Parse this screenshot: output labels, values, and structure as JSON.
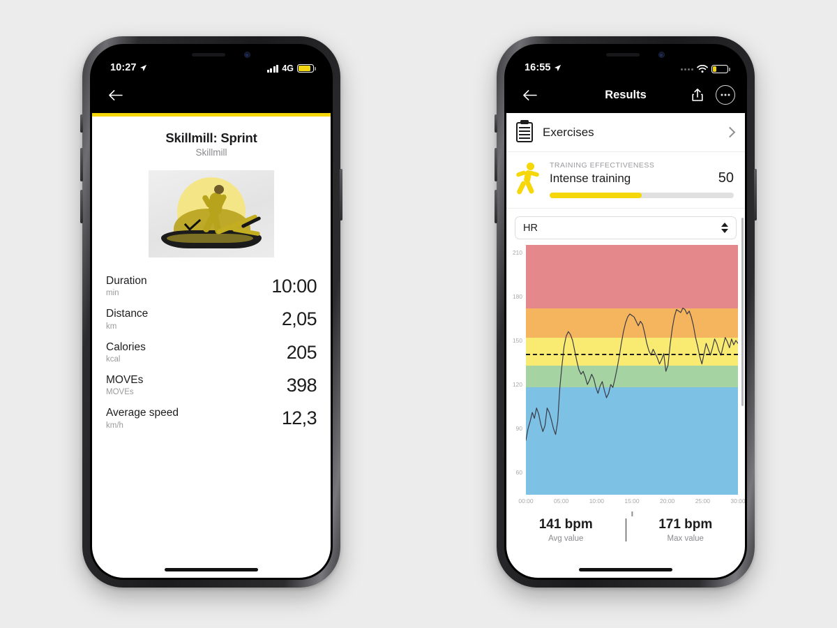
{
  "phone_left": {
    "status_bar": {
      "time": "10:27",
      "location_icon": "location-arrow-icon",
      "network": "4G",
      "signal_icon": "signal-bars-icon",
      "battery_icon": "battery-low-power-icon"
    },
    "nav": {
      "back_icon": "back-arrow-icon"
    },
    "workout": {
      "title": "Skillmill: Sprint",
      "subtitle": "Skillmill",
      "image_alt": "skillmill-treadmill-image"
    },
    "stats": [
      {
        "label": "Duration",
        "unit": "min",
        "value": "10:00"
      },
      {
        "label": "Distance",
        "unit": "km",
        "value": "2,05"
      },
      {
        "label": "Calories",
        "unit": "kcal",
        "value": "205"
      },
      {
        "label": "MOVEs",
        "unit": "MOVEs",
        "value": "398"
      },
      {
        "label": "Average speed",
        "unit": "km/h",
        "value": "12,3"
      }
    ]
  },
  "phone_right": {
    "status_bar": {
      "time": "16:55",
      "location_icon": "location-arrow-icon",
      "signal_icon": "signal-dots-icon",
      "wifi_icon": "wifi-icon",
      "battery_icon": "battery-low-icon"
    },
    "nav": {
      "back_icon": "back-arrow-icon",
      "title": "Results",
      "share_icon": "share-icon",
      "more_icon": "more-options-icon"
    },
    "exercises_row": {
      "label": "Exercises",
      "icon": "clipboard-icon",
      "chevron": "chevron-right-icon"
    },
    "effectiveness": {
      "caption": "TRAINING EFFECTIVENESS",
      "name": "Intense training",
      "score": "50",
      "progress_percent": 50,
      "icon": "running-figure-icon",
      "bar_color": "#f5d70a"
    },
    "selector": {
      "value": "HR",
      "icon": "stepper-arrows-icon"
    },
    "summary": [
      {
        "value": "141 bpm",
        "label": "Avg value"
      },
      {
        "value": "171 bpm",
        "label": "Max value"
      }
    ]
  },
  "chart_data": {
    "type": "line",
    "title": "HR",
    "xlabel": "",
    "ylabel": "",
    "ylim": [
      45,
      215
    ],
    "xlim": [
      0,
      30
    ],
    "grid": false,
    "legend": false,
    "y_ticks": [
      210,
      180,
      150,
      120,
      90,
      60
    ],
    "x_ticks": [
      "00:00",
      "05:00",
      "10:00",
      "15:00",
      "20:00",
      "25:00",
      "30:00"
    ],
    "average_line": {
      "value": 141,
      "style": "dashed",
      "color": "#1c1c1e",
      "label": "Avg value"
    },
    "zones": [
      {
        "name": "zone-1-very-light",
        "color": "#7dc1e5",
        "from": 45,
        "to": 118
      },
      {
        "name": "zone-2-light",
        "color": "#a5d4a2",
        "from": 118,
        "to": 133
      },
      {
        "name": "zone-3-moderate",
        "color": "#f9eb72",
        "from": 133,
        "to": 152
      },
      {
        "name": "zone-4-hard",
        "color": "#f5b45e",
        "from": 152,
        "to": 172
      },
      {
        "name": "zone-5-maximum",
        "color": "#e5888b",
        "from": 172,
        "to": 215
      }
    ],
    "series": [
      {
        "name": "Heart rate",
        "color": "#3a3a46",
        "unit": "bpm",
        "x": [
          0.0,
          0.3,
          0.6,
          0.9,
          1.2,
          1.5,
          1.8,
          2.1,
          2.4,
          2.7,
          3.0,
          3.3,
          3.6,
          3.9,
          4.2,
          4.5,
          4.8,
          5.1,
          5.4,
          5.7,
          6.0,
          6.3,
          6.6,
          6.9,
          7.2,
          7.5,
          7.8,
          8.1,
          8.4,
          8.7,
          9.0,
          9.3,
          9.6,
          9.9,
          10.2,
          10.5,
          10.8,
          11.1,
          11.4,
          11.7,
          12.0,
          12.3,
          12.6,
          12.9,
          13.2,
          13.5,
          13.8,
          14.1,
          14.4,
          14.7,
          15.0,
          15.3,
          15.6,
          15.9,
          16.2,
          16.5,
          16.8,
          17.1,
          17.4,
          17.7,
          18.0,
          18.3,
          18.6,
          18.9,
          19.2,
          19.5,
          19.8,
          20.1,
          20.4,
          20.7,
          21.0,
          21.3,
          21.6,
          21.9,
          22.2,
          22.5,
          22.8,
          23.1,
          23.4,
          23.7,
          24.0,
          24.3,
          24.6,
          24.9,
          25.2,
          25.5,
          25.8,
          26.1,
          26.4,
          26.7,
          27.0,
          27.3,
          27.6,
          27.9,
          28.2,
          28.5,
          28.8,
          29.1,
          29.4,
          29.7,
          30.0
        ],
        "y": [
          82,
          90,
          95,
          101,
          97,
          104,
          100,
          93,
          88,
          92,
          104,
          101,
          96,
          90,
          86,
          95,
          118,
          133,
          146,
          153,
          156,
          154,
          150,
          143,
          136,
          130,
          127,
          129,
          125,
          120,
          123,
          127,
          124,
          118,
          114,
          119,
          122,
          116,
          111,
          114,
          120,
          118,
          124,
          131,
          139,
          148,
          156,
          162,
          166,
          168,
          167,
          166,
          163,
          160,
          163,
          161,
          155,
          148,
          143,
          140,
          144,
          141,
          138,
          134,
          137,
          141,
          129,
          133,
          147,
          158,
          166,
          171,
          170,
          169,
          172,
          171,
          168,
          170,
          166,
          160,
          152,
          146,
          139,
          134,
          141,
          148,
          144,
          140,
          145,
          151,
          148,
          143,
          140,
          146,
          152,
          149,
          145,
          151,
          147,
          150,
          148
        ]
      }
    ]
  }
}
